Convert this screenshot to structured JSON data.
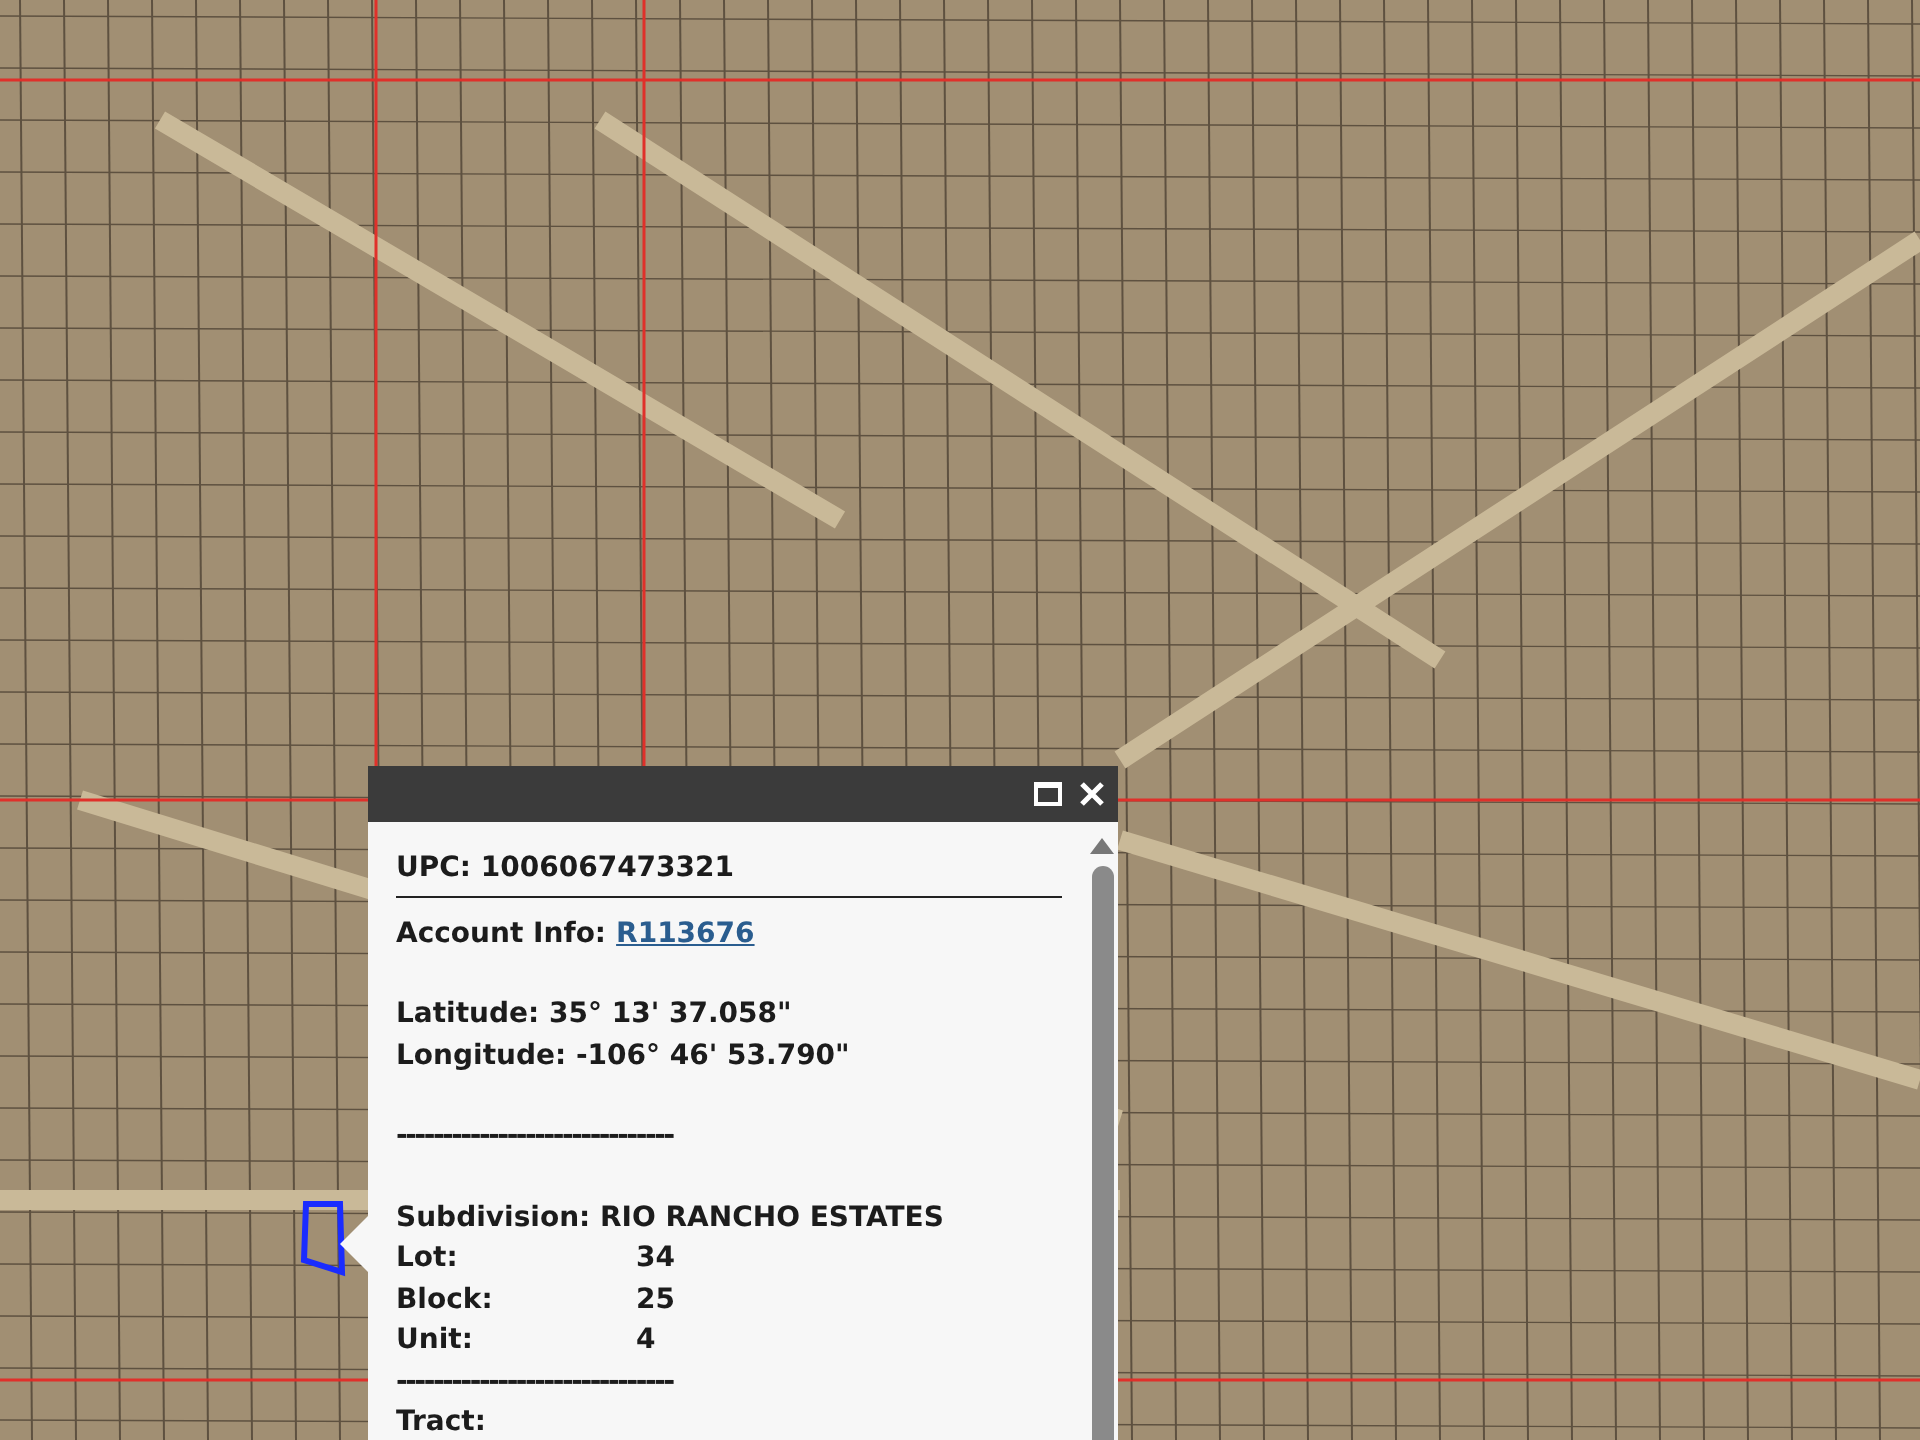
{
  "popup": {
    "upc": "UPC: 1006067473321",
    "account": {
      "label": "Account Info:",
      "link": "R113676"
    },
    "latitude": "Latitude: 35° 13' 37.058\"",
    "longitude": "Longitude: -106° 46' 53.790\"",
    "separator_1": "------------------------------",
    "subdivision": "Subdivision: RIO RANCHO ESTATES",
    "parcel_fields": [
      {
        "label": "Lot:",
        "value": "34"
      },
      {
        "label": "Block:",
        "value": "25"
      },
      {
        "label": "Unit:",
        "value": "4"
      }
    ],
    "separator_2": "------------------------------",
    "tract": "Tract:"
  }
}
